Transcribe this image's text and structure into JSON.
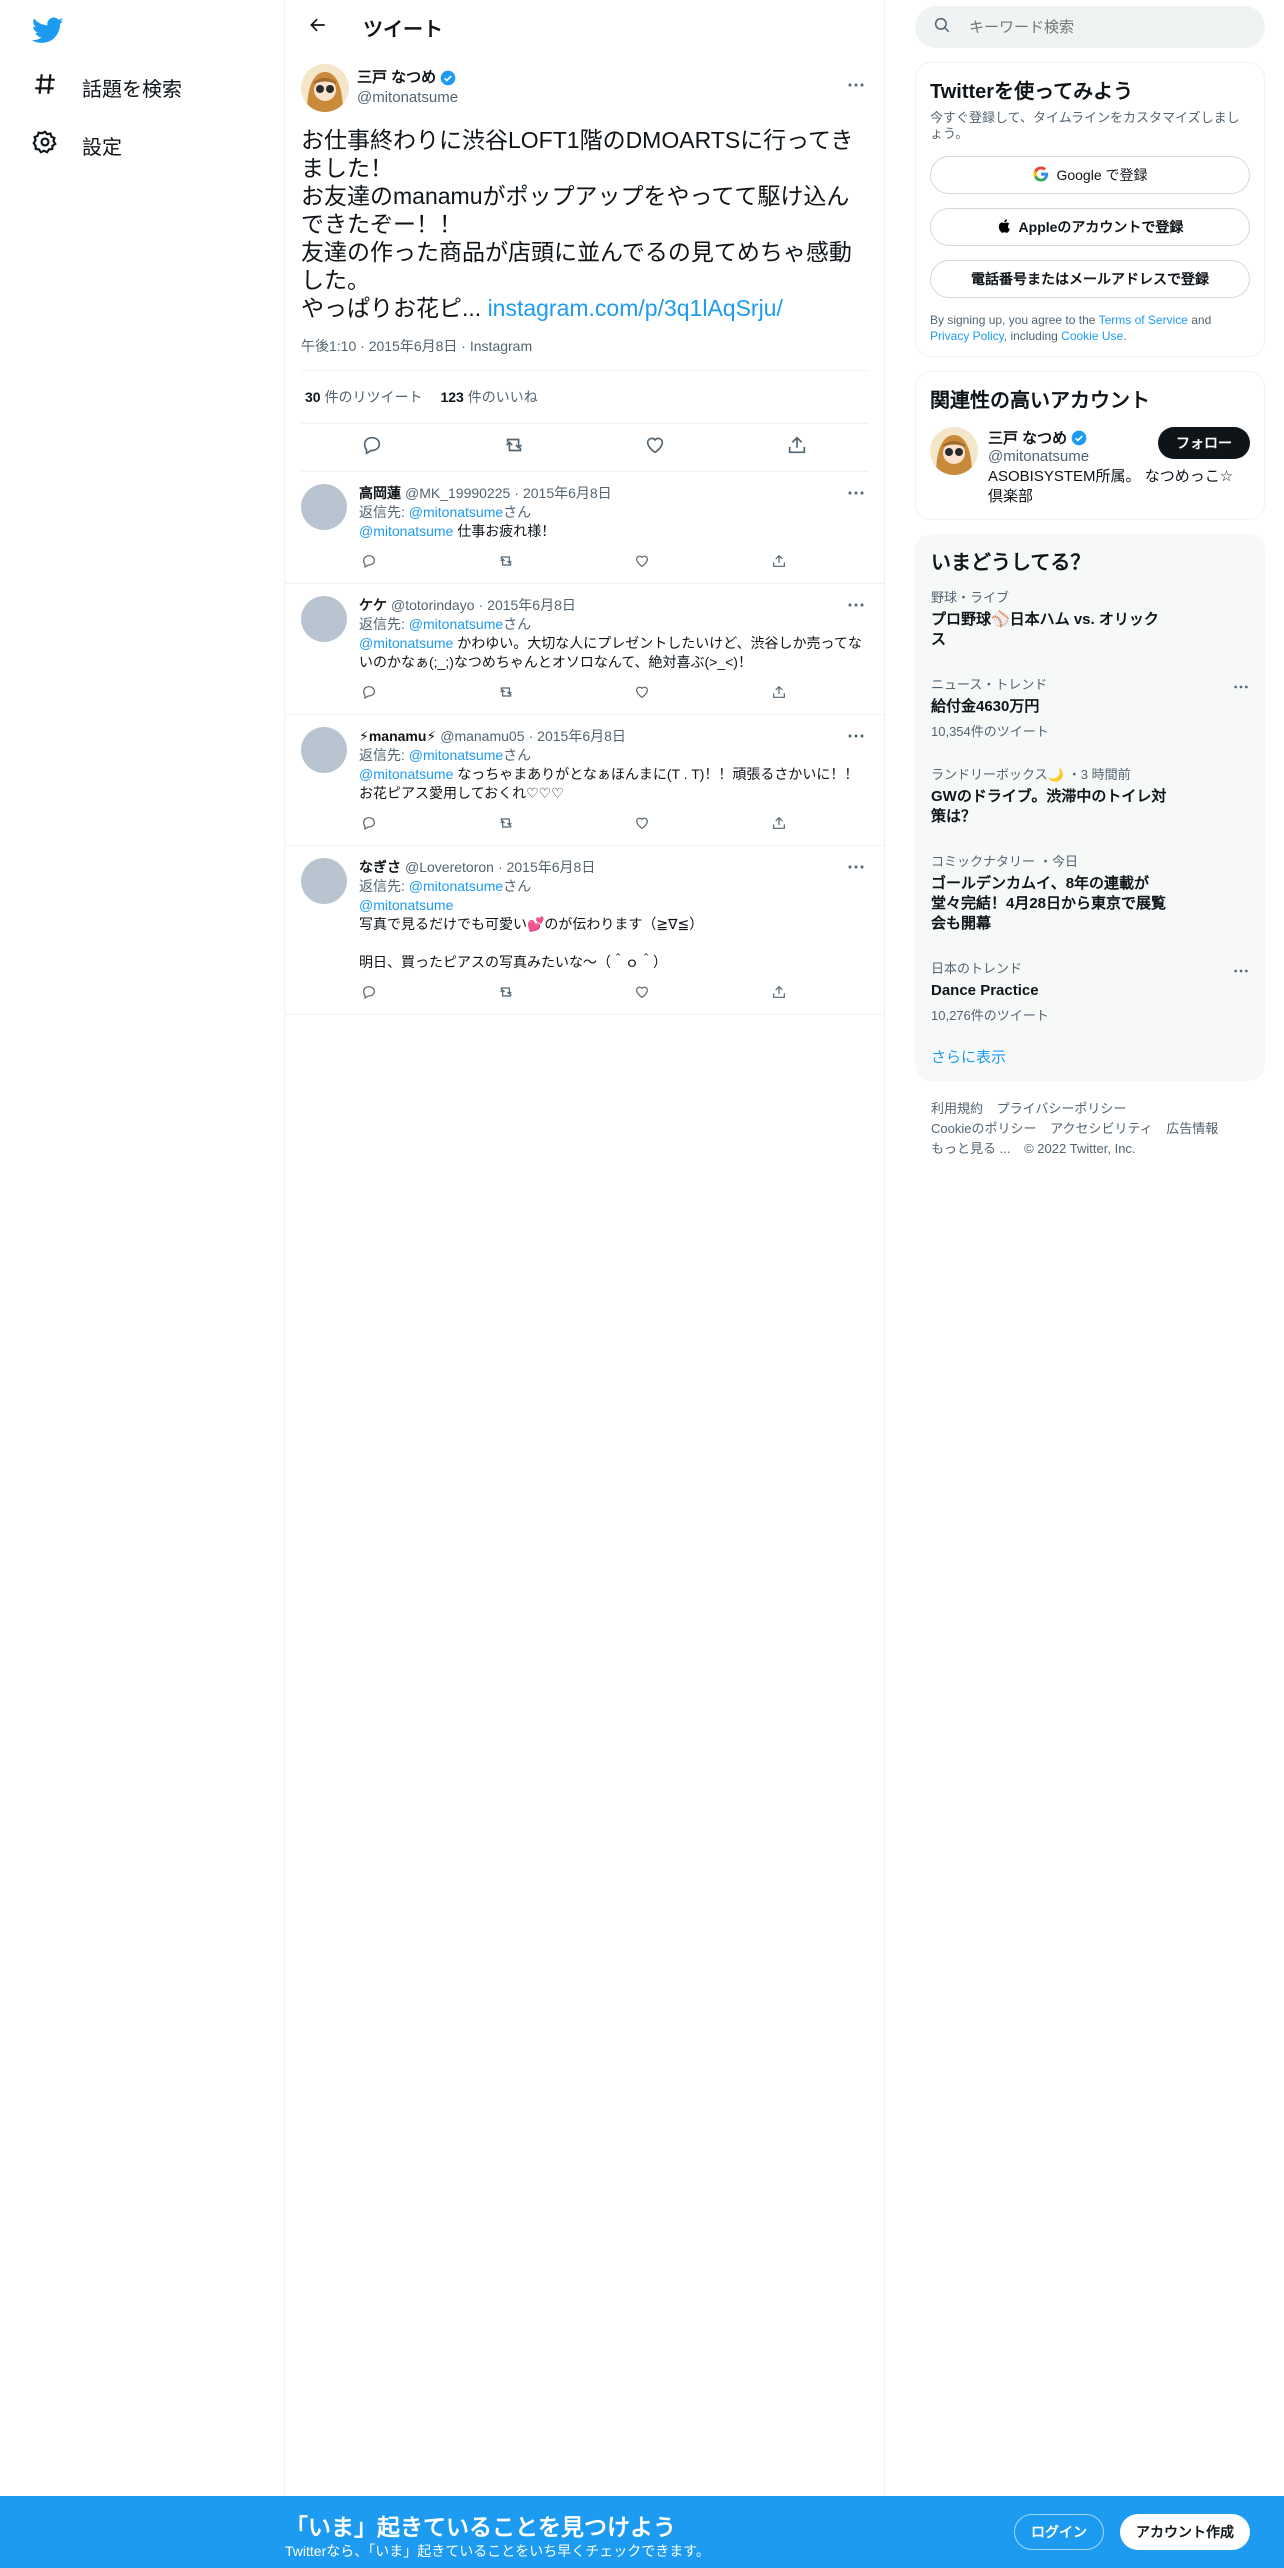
{
  "nav": {
    "explore_label": "話題を検索",
    "settings_label": "設定"
  },
  "header": {
    "title": "ツイート"
  },
  "main_tweet": {
    "name": "三戸 なつめ",
    "handle": "@mitonatsume",
    "text": "お仕事終わりに渋谷LOFT1階のDMOARTSに行ってきました！\nお友達のmanamuがポップアップをやってて駆け込んできたぞー！！\n友達の作った商品が店頭に並んでるの見てめちゃ感動した。\nやっぱりお花ピ... ",
    "link": "instagram.com/p/3q1lAqSrju/",
    "time": "午後1:10",
    "date": "2015年6月8日",
    "source": "Instagram",
    "retweets_count": "30",
    "retweets_label": "件のリツイート",
    "likes_count": "123",
    "likes_label": "件のいいね"
  },
  "replies": [
    {
      "name": "高岡蓮",
      "handle": "@MK_19990225",
      "date": "2015年6月8日",
      "reply_prefix": "返信先: ",
      "reply_to": "@mitonatsume",
      "reply_suffix": "さん",
      "mention": "@mitonatsume",
      "text": " 仕事お疲れ様！"
    },
    {
      "name": "ケケ",
      "handle": "@totorindayo",
      "date": "2015年6月8日",
      "reply_prefix": "返信先: ",
      "reply_to": "@mitonatsume",
      "reply_suffix": "さん",
      "mention": "@mitonatsume",
      "text": " かわゆい。大切な人にプレゼントしたいけど、渋谷しか売ってないのかなぁ(;_;)なつめちゃんとオソロなんて、絶対喜ぶ(>_<)！"
    },
    {
      "name": "⚡manamu⚡",
      "handle": "@manamu05",
      "date": "2015年6月8日",
      "reply_prefix": "返信先: ",
      "reply_to": "@mitonatsume",
      "reply_suffix": "さん",
      "mention": "@mitonatsume",
      "text": " なっちゃまありがとなぁほんまに(T . T)！！頑張るさかいに！！お花ピアス愛用しておくれ♡♡♡"
    },
    {
      "name": "なぎさ",
      "handle": "@Loveretoron",
      "date": "2015年6月8日",
      "reply_prefix": "返信先: ",
      "reply_to": "@mitonatsume",
      "reply_suffix": "さん",
      "mention": "@mitonatsume",
      "text": "\n写真で見るだけでも可愛い💕のが伝わります（≧∇≦）\n\n明日、買ったピアスの写真みたいな〜（＾ｏ＾）"
    }
  ],
  "search": {
    "placeholder": "キーワード検索"
  },
  "signup_card": {
    "title": "Twitterを使ってみよう",
    "subtitle": "今すぐ登録して、タイムラインをカスタマイズしましょう。",
    "google_label": "Google で登録",
    "apple_label": "Appleのアカウントで登録",
    "phone_label": "電話番号またはメールアドレスで登録",
    "terms_prefix": "By signing up, you agree to the ",
    "terms_link": "Terms of Service",
    "terms_and": " and ",
    "privacy_link": "Privacy Policy",
    "terms_including": ", including ",
    "cookie_link": "Cookie Use",
    "terms_end": "."
  },
  "related": {
    "title": "関連性の高いアカウント",
    "name": "三戸 なつめ",
    "handle": "@mitonatsume",
    "follow_label": "フォロー",
    "bio": "ASOBISYSTEM所属。 なつめっこ☆倶楽部"
  },
  "trends": {
    "title": "いまどうしてる？",
    "items": [
      {
        "meta": "野球・ライブ",
        "title": "プロ野球⚾日本ハム vs. オリックス",
        "count": ""
      },
      {
        "meta": "ニュース・トレンド",
        "title": "給付金4630万円",
        "count": "10,354件のツイート"
      },
      {
        "meta": "ランドリーボックス🌙",
        "meta_time": "・3 時間前",
        "title": "GWのドライブ。渋滞中のトイレ対策は？",
        "count": ""
      },
      {
        "meta": "コミックナタリー",
        "meta_time": "・今日",
        "title": "ゴールデンカムイ、8年の連載が堂々完結！4月28日から東京で展覧会も開幕",
        "count": ""
      },
      {
        "meta": "日本のトレンド",
        "title": "Dance Practice",
        "count": "10,276件のツイート"
      }
    ],
    "show_more": "さらに表示"
  },
  "footer": {
    "links": [
      "利用規約",
      "プライバシーポリシー",
      "Cookieのポリシー",
      "アクセシビリティ",
      "広告情報",
      "もっと見る ..."
    ],
    "copyright": "© 2022 Twitter, Inc."
  },
  "bottombar": {
    "title": "「いま」起きていることを見つけよう",
    "subtitle": "Twitterなら、「いま」起きていることをいち早くチェックできます。",
    "login_label": "ログイン",
    "signup_label": "アカウント作成"
  },
  "colors": {
    "accent": "#1d9bf0",
    "text": "#0f1419",
    "secondary": "#536471"
  }
}
